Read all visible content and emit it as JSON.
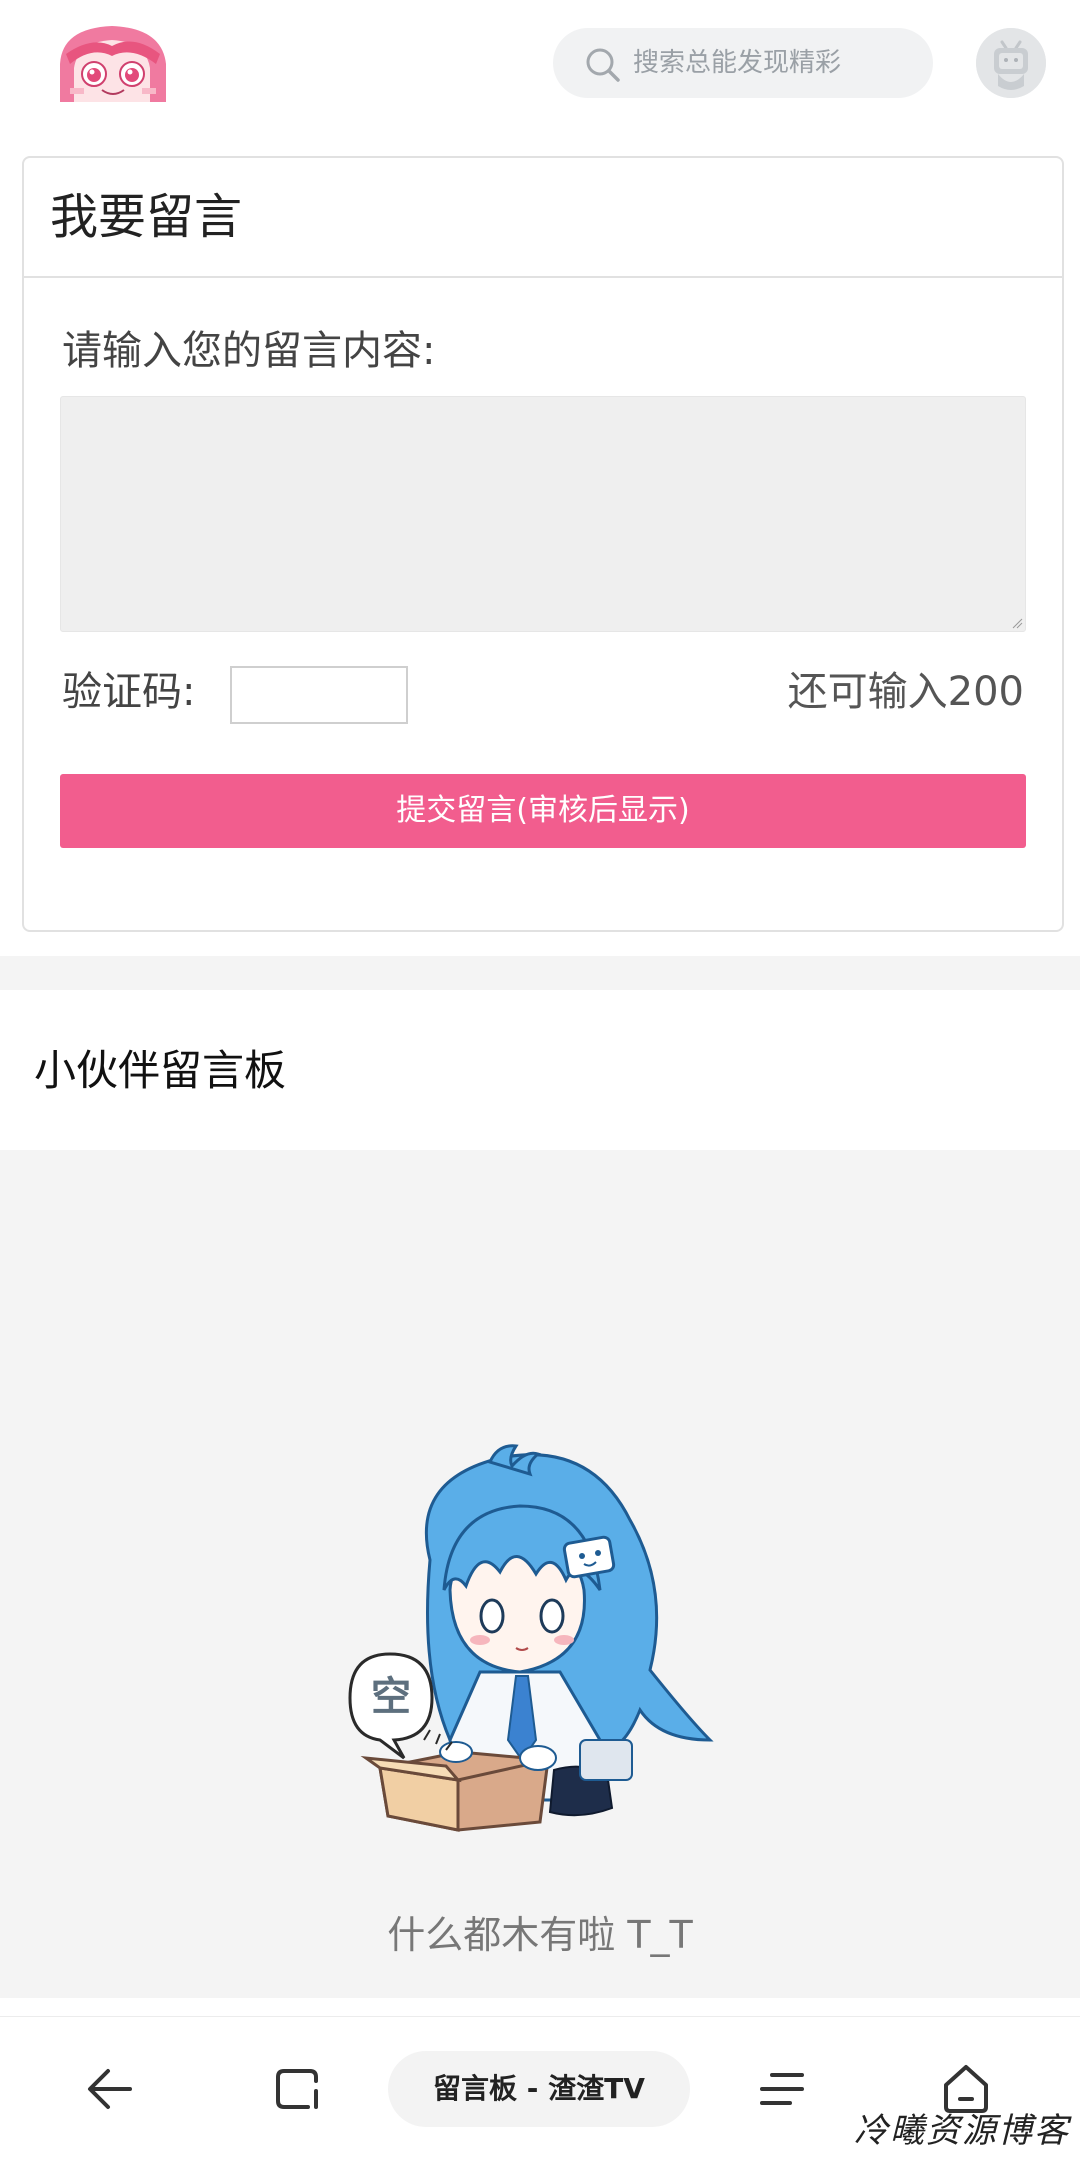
{
  "header": {
    "search_placeholder": "搜索总能发现精彩"
  },
  "form": {
    "title": "我要留言",
    "content_label": "请输入您的留言内容:",
    "textarea_value": "",
    "captcha_label": "验证码:",
    "captcha_value": "",
    "remaining_text": "还可输入200",
    "submit_label": "提交留言(审核后显示)"
  },
  "board": {
    "title": "小伙伴留言板",
    "empty_text": "什么都木有啦 T_T",
    "empty_badge_text": "空"
  },
  "bottom_bar": {
    "page_title": "留言板 - 渣渣TV",
    "icons": [
      "back-arrow-icon",
      "tabs-icon",
      "menu-icon",
      "home-icon"
    ]
  },
  "watermark": "冷曦资源博客",
  "colors": {
    "accent": "#f25d8e",
    "search_bg": "#f1f2f3",
    "empty_bg": "#f4f4f4"
  }
}
